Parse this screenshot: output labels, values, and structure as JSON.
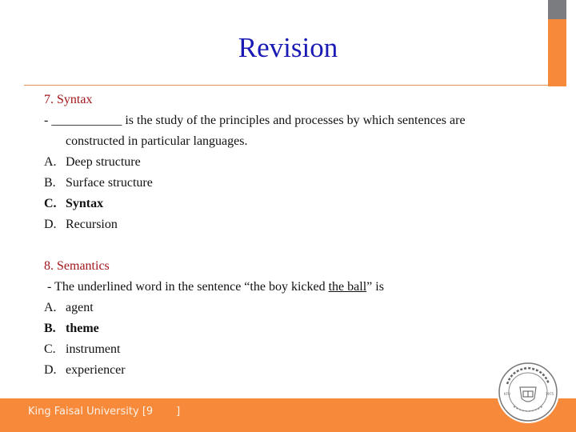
{
  "slide": {
    "title": "Revision",
    "footer": {
      "text": "King Faisal University [9       ]"
    },
    "logo": "university-seal-icon"
  },
  "questions": [
    {
      "heading": "7. Syntax",
      "prompt_line1": "- ___________ is the study of the principles and processes by which sentences are",
      "prompt_line2": "constructed in particular languages.",
      "options": [
        {
          "letter": "A.",
          "text": "Deep structure",
          "correct": false
        },
        {
          "letter": "B.",
          "text": "Surface structure",
          "correct": false
        },
        {
          "letter": "C.",
          "text": "Syntax",
          "correct": true
        },
        {
          "letter": "D.",
          "text": "Recursion",
          "correct": false
        }
      ]
    },
    {
      "heading": "8. Semantics",
      "prompt_before": " - The underlined word in the sentence “the boy kicked ",
      "prompt_underlined": "the ball",
      "prompt_after": "” is",
      "options": [
        {
          "letter": "A.",
          "text": "agent",
          "correct": false
        },
        {
          "letter": "B.",
          "text": "theme",
          "correct": true
        },
        {
          "letter": "C.",
          "text": "instrument",
          "correct": false
        },
        {
          "letter": "D.",
          "text": "experiencer",
          "correct": false
        }
      ]
    }
  ]
}
